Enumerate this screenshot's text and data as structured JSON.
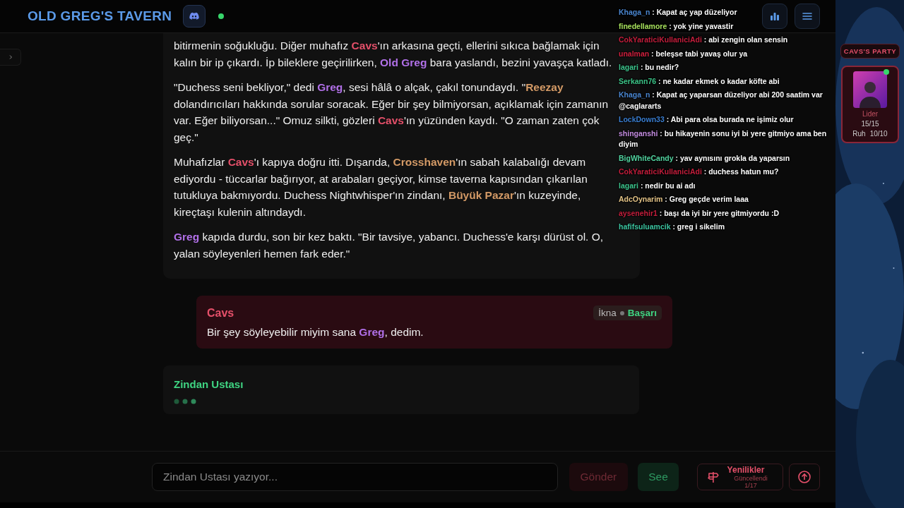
{
  "header": {
    "title": "OLD GREG'S TAVERN",
    "online": true
  },
  "story": {
    "paragraphs": [
      [
        {
          "kind": "plain",
          "text": "bitirmenin soğukluğu. Diğer muhafız "
        },
        {
          "kind": "player",
          "text": "Cavs"
        },
        {
          "kind": "plain",
          "text": "'ın arkasına geçti, ellerini sıkıca bağlamak için kalın bir ip çıkardı. İp bileklere geçirilirken, "
        },
        {
          "kind": "npc",
          "text": "Old Greg"
        },
        {
          "kind": "plain",
          "text": " bara yaslandı, bezini yavaşça katladı."
        }
      ],
      [
        {
          "kind": "plain",
          "text": "\"Duchess seni bekliyor,\" dedi "
        },
        {
          "kind": "npc",
          "text": "Greg"
        },
        {
          "kind": "plain",
          "text": ", sesi hâlâ o alçak, çakıl tonundaydı. \""
        },
        {
          "kind": "place",
          "text": "Reezay"
        },
        {
          "kind": "plain",
          "text": " dolandırıcıları hakkında sorular soracak. Eğer bir şey bilmiyorsan, açıklamak için zamanın var. Eğer biliyorsan...\" Omuz silkti, gözleri "
        },
        {
          "kind": "player",
          "text": "Cavs"
        },
        {
          "kind": "plain",
          "text": "'ın yüzünden kaydı. \"O zaman zaten çok geç.\""
        }
      ],
      [
        {
          "kind": "plain",
          "text": "Muhafızlar "
        },
        {
          "kind": "player",
          "text": "Cavs"
        },
        {
          "kind": "plain",
          "text": "'ı kapıya doğru itti. Dışarıda, "
        },
        {
          "kind": "place",
          "text": "Crosshaven"
        },
        {
          "kind": "plain",
          "text": "'ın sabah kalabalığı devam ediyordu - tüccarlar bağırıyor, at arabaları geçiyor, kimse taverna kapısından çıkarılan tutukluya bakmıyordu. Duchess Nightwhisper'ın zindanı, "
        },
        {
          "kind": "place",
          "text": "Büyük Pazar"
        },
        {
          "kind": "plain",
          "text": "'ın kuzeyinde, kireçtaşı kulenin altındaydı."
        }
      ],
      [
        {
          "kind": "npc",
          "text": "Greg"
        },
        {
          "kind": "plain",
          "text": " kapıda durdu, son bir kez baktı. \"Bir tavsiye, yabancı. Duchess'e karşı dürüst ol. O, yalan söyleyenleri hemen fark eder.\""
        }
      ]
    ]
  },
  "action": {
    "speaker": "Cavs",
    "segments": [
      {
        "kind": "plain",
        "text": "Bir şey söyleyebilir miyim sana "
      },
      {
        "kind": "npc",
        "text": "Greg"
      },
      {
        "kind": "plain",
        "text": ", dedim."
      }
    ],
    "skill": "İkna",
    "result": "Başarı",
    "success": true
  },
  "narrator": {
    "name": "Zindan Ustası",
    "typing": true
  },
  "input": {
    "placeholder": "Zindan Ustası yazıyor..."
  },
  "buttons": {
    "send": {
      "label": "Gönder",
      "disabled": true
    },
    "see": {
      "label": "See"
    },
    "news": {
      "title": "Yenilikler",
      "subtitle": "Güncellendi 1/17"
    }
  },
  "party": {
    "title": "CAVS'S PARTY",
    "member": {
      "role": "Lider",
      "online": true,
      "stats": [
        {
          "value": "15/15"
        },
        {
          "label": "Ruh",
          "value": "10/10"
        }
      ]
    }
  },
  "chat": [
    {
      "user": "Khaga_n",
      "color": "#4a86d0",
      "text": ": Kapat aç yap düzeliyor"
    },
    {
      "user": "finedellamore",
      "color": "#a6e05c",
      "text": ": yok yine yavastir"
    },
    {
      "user": "CokYaraticiKullaniciAdi",
      "color": "#c41e3c",
      "text": ": abi zengin olan sensin"
    },
    {
      "user": "unalman",
      "color": "#d0203e",
      "text": ": beleşse tabi yavaş olur ya"
    },
    {
      "user": "lagari",
      "color": "#3cc48c",
      "text": ": bu nedir?"
    },
    {
      "user": "Serkann76",
      "color": "#3cc488",
      "text": ": ne kadar ekmek o kadar köfte abi"
    },
    {
      "user": "Khaga_n",
      "color": "#4a86d0",
      "text": ": Kapat aç yaparsan düzeliyor abi 200 saatim var @caglararts"
    },
    {
      "user": "LockDown33",
      "color": "#3a7ed0",
      "text": ": Abi para olsa burada ne işimiz olur"
    },
    {
      "user": "shinganshi",
      "color": "#c38ce0",
      "text": ": bu hikayenin sonu iyi bi yere gitmiyo ama ben diyim"
    },
    {
      "user": "BigWhiteCandy",
      "color": "#52d4a0",
      "text": ": yav aynısını grokla da yaparsın"
    },
    {
      "user": "CokYaraticiKullaniciAdi",
      "color": "#c41e3c",
      "text": ": duchess hatun mu?"
    },
    {
      "user": "lagari",
      "color": "#3cc48c",
      "text": ": nedir bu ai adı"
    },
    {
      "user": "AdcOynarim",
      "color": "#e2c286",
      "text": ": Greg geçde verim laaa"
    },
    {
      "user": "aysenehir1",
      "color": "#c41e3c",
      "text": ": başı da iyi bir yere gitmiyordu :D"
    },
    {
      "user": "hafifsuluamcik",
      "color": "#3cc4a0",
      "text": ": greg i sikelim"
    }
  ]
}
